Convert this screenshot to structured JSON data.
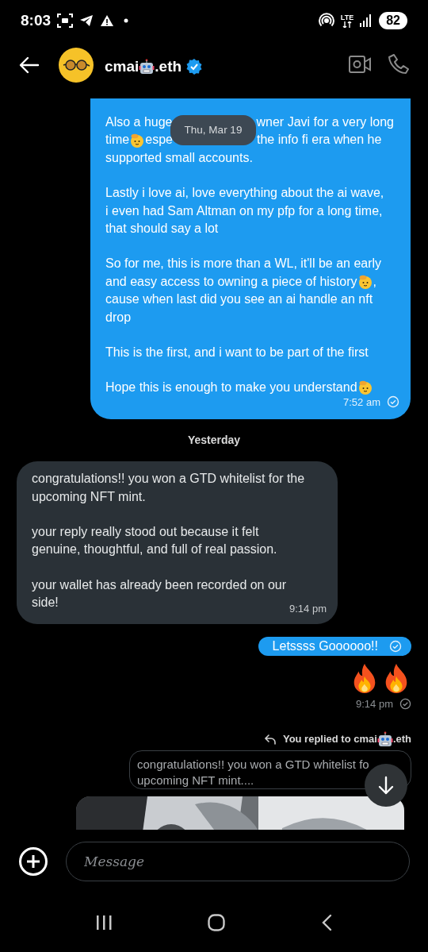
{
  "status_bar": {
    "time": "8:03",
    "network": "LTE",
    "battery": "82"
  },
  "header": {
    "name": [
      "cmai",
      {
        "kind": "robot"
      },
      ".eth"
    ],
    "verified": true
  },
  "date_pill": "Thu, Mar 19",
  "messages": [
    {
      "kind": "sent",
      "paragraphs": [
        [
          [
            "Also a huge",
            {
              "kind": "covered"
            },
            "wner Javi for a very long"
          ],
          [
            "time",
            {
              "kind": "face"
            },
            " espe",
            {
              "kind": "covered"
            },
            "the info fi era when he"
          ],
          [
            "supported small accounts."
          ]
        ],
        [
          [
            "Lastly i love ai, love everything about the ai wave,"
          ],
          [
            "i even had Sam Altman on my pfp for a long time,"
          ],
          [
            "that should say a lot"
          ]
        ],
        [
          [
            "So for me, this is more than a WL, it'll be an early"
          ],
          [
            "and easy access to owning a piece of history ",
            {
              "kind": "face"
            },
            ","
          ],
          [
            "cause when last did you see an ai handle an nft"
          ],
          [
            "drop"
          ]
        ],
        [
          [
            "This is the first, and i want to be part of the first"
          ]
        ],
        [
          [
            "Hope this is enough to make you understand ",
            {
              "kind": "face"
            }
          ]
        ]
      ],
      "time": "7:52 am",
      "read": true
    },
    {
      "kind": "separator",
      "text": "Yesterday"
    },
    {
      "kind": "received",
      "paragraphs": [
        [
          [
            "congratulations!! you won a GTD whitelist for the"
          ],
          [
            "upcoming NFT mint."
          ]
        ],
        [
          [
            "your reply really stood out because it felt"
          ],
          [
            "genuine, thoughtful, and full of real passion."
          ]
        ],
        [
          [
            "your wallet has already been recorded on our"
          ],
          [
            "side!"
          ]
        ]
      ],
      "time": "9:14 pm"
    },
    {
      "kind": "short_sent",
      "text": "Letssss Goooooo!!",
      "read": true
    },
    {
      "kind": "fire_emojis"
    },
    {
      "kind": "timestamp",
      "time": "9:14 pm",
      "read": true
    },
    {
      "kind": "reply",
      "label": [
        "You replied to cmai",
        {
          "kind": "robot"
        },
        ".eth"
      ],
      "quote_lines": [
        "congratulations!! you won a GTD whitelist fo",
        "upcoming NFT mint...."
      ]
    }
  ],
  "composer": {
    "placeholder": "Message"
  }
}
